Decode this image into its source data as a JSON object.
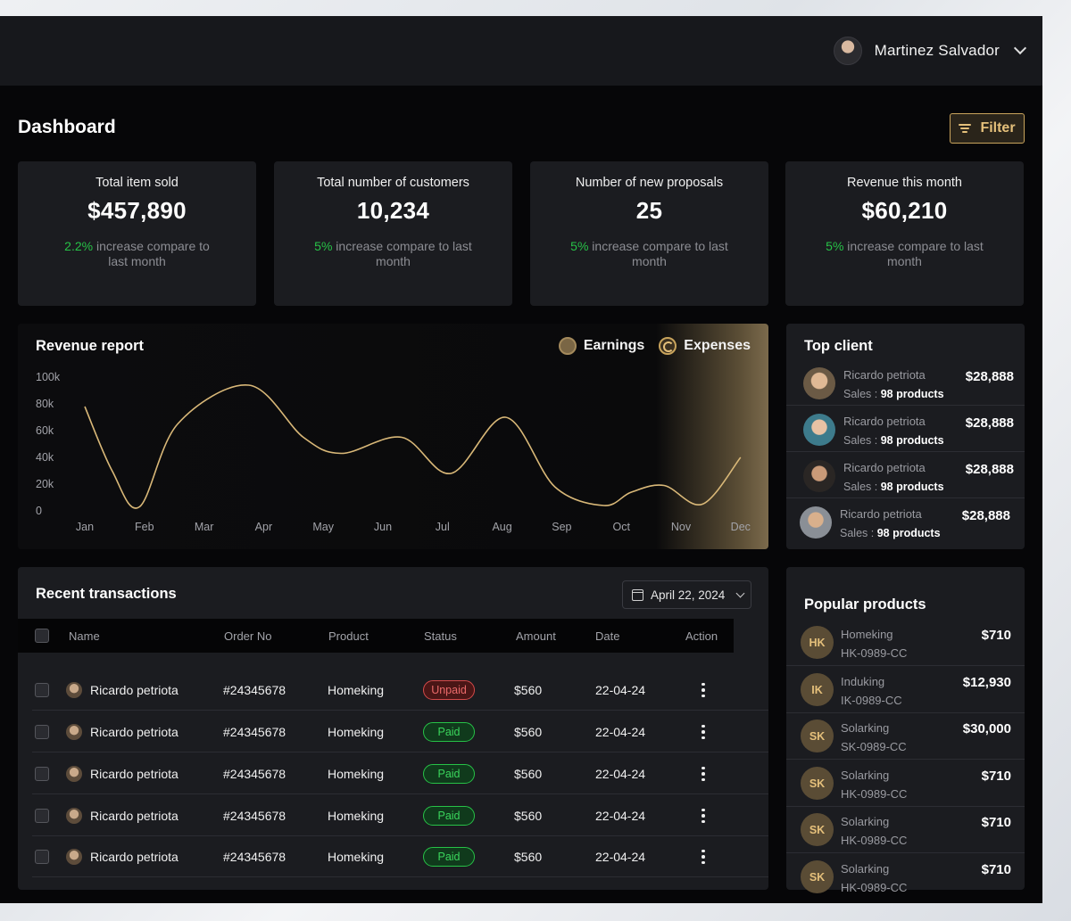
{
  "header": {
    "user_name": "Martinez Salvador"
  },
  "page": {
    "title": "Dashboard",
    "filter_label": "Filter"
  },
  "stats": [
    {
      "label": "Total item sold",
      "value": "$457,890",
      "pct": "2.2%",
      "note": " increase compare to last month"
    },
    {
      "label": "Total number of customers",
      "value": "10,234",
      "pct": "5%",
      "note": " increase compare to last month"
    },
    {
      "label": "Number of new proposals",
      "value": "25",
      "pct": "5%",
      "note": " increase compare to last month"
    },
    {
      "label": "Revenue this month",
      "value": "$60,210",
      "pct": "5%",
      "note": " increase compare to last month"
    }
  ],
  "revenue_report": {
    "title": "Revenue report",
    "legend": {
      "earnings": "Earnings",
      "expenses": "Expenses"
    },
    "accent_color": "#d9b878"
  },
  "chart_data": {
    "type": "line",
    "categories": [
      "Jan",
      "Feb",
      "Mar",
      "Apr",
      "May",
      "Jun",
      "Jul",
      "Aug",
      "Sep",
      "Oct",
      "Nov",
      "Dec"
    ],
    "y_ticks": [
      "100k",
      "80k",
      "60k",
      "40k",
      "20k",
      "0"
    ],
    "ylim": [
      0,
      100000
    ],
    "series": [
      {
        "values": [
          78000,
          30000,
          3000,
          65000,
          94000,
          55000,
          43000,
          55000,
          28000,
          70000,
          18000,
          4000,
          14000,
          19000,
          5000,
          40000
        ],
        "x_positions": [
          0,
          0.5,
          1,
          1.7,
          3,
          4,
          4.7,
          5.8,
          6.7,
          7.7,
          8.6,
          9.5,
          10,
          10.6,
          11.3,
          12
        ]
      }
    ],
    "grid": false,
    "legend_position": "top-right"
  },
  "top_client": {
    "title": "Top client",
    "clients": [
      {
        "name": "Ricardo petriota",
        "sales_prefix": "Sales : ",
        "sales": "98 products",
        "amount": "$28,888"
      },
      {
        "name": "Ricardo petriota",
        "sales_prefix": "Sales : ",
        "sales": "98 products",
        "amount": "$28,888"
      },
      {
        "name": "Ricardo petriota",
        "sales_prefix": "Sales : ",
        "sales": "98 products",
        "amount": "$28,888"
      },
      {
        "name": "Ricardo petriota",
        "sales_prefix": "Sales : ",
        "sales": "98 products",
        "amount": "$28,888"
      }
    ]
  },
  "transactions": {
    "title": "Recent transactions",
    "date": "April 22, 2024",
    "columns": [
      "Name",
      "Order No",
      "Product",
      "Status",
      "Amount",
      "Date",
      "Action"
    ],
    "rows": [
      {
        "name": "Ricardo petriota",
        "order": "#24345678",
        "product": "Homeking",
        "status": "Unpaid",
        "amount": "$560",
        "date": "22-04-24"
      },
      {
        "name": "Ricardo petriota",
        "order": "#24345678",
        "product": "Homeking",
        "status": "Paid",
        "amount": "$560",
        "date": "22-04-24"
      },
      {
        "name": "Ricardo petriota",
        "order": "#24345678",
        "product": "Homeking",
        "status": "Paid",
        "amount": "$560",
        "date": "22-04-24"
      },
      {
        "name": "Ricardo petriota",
        "order": "#24345678",
        "product": "Homeking",
        "status": "Paid",
        "amount": "$560",
        "date": "22-04-24"
      },
      {
        "name": "Ricardo petriota",
        "order": "#24345678",
        "product": "Homeking",
        "status": "Paid",
        "amount": "$560",
        "date": "22-04-24"
      }
    ]
  },
  "popular_products": {
    "title": "Popular products",
    "items": [
      {
        "initials": "HK",
        "name": "Homeking",
        "code": "HK-0989-CC",
        "price": "$710"
      },
      {
        "initials": "IK",
        "name": "Induking",
        "code": "IK-0989-CC",
        "price": "$12,930"
      },
      {
        "initials": "SK",
        "name": "Solarking",
        "code": "SK-0989-CC",
        "price": "$30,000"
      },
      {
        "initials": "SK",
        "name": "Solarking",
        "code": "HK-0989-CC",
        "price": "$710"
      },
      {
        "initials": "SK",
        "name": "Solarking",
        "code": "HK-0989-CC",
        "price": "$710"
      },
      {
        "initials": "SK",
        "name": "Solarking",
        "code": "HK-0989-CC",
        "price": "$710"
      }
    ]
  }
}
